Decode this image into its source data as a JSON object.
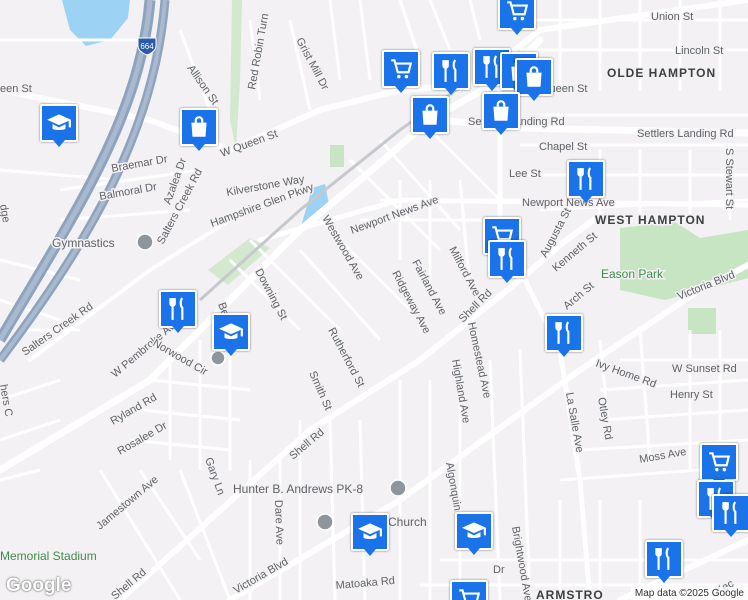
{
  "map": {
    "area_labels": [
      "OLDE HAMPTON",
      "WEST HAMPTON"
    ],
    "park_label": "Eason Park",
    "stadium_label": "Memorial Stadium",
    "poi_labels": {
      "gymnastics": "Gymnastics",
      "school": "Hunter B. Andrews PK-8",
      "church": "Church"
    },
    "streets": {
      "union": "Union St",
      "lincoln": "Lincoln St",
      "queen_e": "Queen St",
      "queen_w": "een St",
      "w_queen": "W Queen St",
      "settlers": "Settlers Landing Rd",
      "settlers2": "Settlers Landing Rd",
      "chapel": "Chapel St",
      "lee": "Lee St",
      "s_stewart": "S Stewart St",
      "newport": "Newport News Ave",
      "newport2": "Newport News Ave",
      "augusta": "Augusta St",
      "kenneth": "Kenneth St",
      "arch": "Arch St",
      "victoria_e": "Victoria Blvd",
      "victoria_w": "Victoria Blvd",
      "w_sunset": "W Sunset Rd",
      "henry": "Henry St",
      "ivy": "Ivy Home Rd",
      "otley": "Otley Rd",
      "moss": "Moss Ave",
      "la_salle": "La Salle Ave",
      "brightwood": "Brightwood Ave",
      "algonquin": "Algonquin Rd",
      "highland": "Highland Ave",
      "homestead": "Homestead Ave",
      "milford": "Milford Ave",
      "fairland": "Fairland Ave",
      "ridgeway": "Ridgeway Ave",
      "shell_e": "Shell Rd",
      "shell_w": "Shell Rd",
      "shell_sw": "Shell Rd",
      "rutherford": "Rutherford St",
      "smith": "Smith St",
      "downing": "Downing St",
      "westwood": "Westwood Ave",
      "hampshire": "Hampshire Glen Pkwy",
      "kilverstone": "Kilverstone Way",
      "salters": "Salters Creek Rd",
      "salters2": "Salters Creek Rd",
      "azalea": "Azalea Dr",
      "balmoral": "Balmoral Dr",
      "braemar": "Braemar Dr",
      "allison": "Allison St",
      "red_robin": "Red Robin Turn",
      "grist_mill": "Grist Mill Dr",
      "w_pembroke": "W Pembroke Ave",
      "norwood": "Norwood Cir",
      "ryland": "Ryland Rd",
      "rosalee": "Rosalee Dr",
      "gary": "Gary Ln",
      "jamestown": "Jamestown Ave",
      "dare": "Dare Ave",
      "matoaka": "Matoaka Rd",
      "kecoughtan": "Kec",
      "armstrong": "ARMSTRO",
      "dr": "Dr",
      "ridge": "dge",
      "chers": "hers C",
      "be": "Be"
    },
    "highway_shield": "664",
    "attribution": "Map data ©2025 Google",
    "logo": "Google"
  },
  "markers": [
    {
      "icon": "shopping-cart-icon"
    },
    {
      "icon": "shopping-cart-icon"
    },
    {
      "icon": "restaurant-icon"
    },
    {
      "icon": "restaurant-icon"
    },
    {
      "icon": "shopping-bag-icon"
    },
    {
      "icon": "shopping-bag-icon"
    },
    {
      "icon": "shopping-bag-icon"
    },
    {
      "icon": "shopping-bag-icon"
    },
    {
      "icon": "school-icon"
    },
    {
      "icon": "restaurant-icon"
    },
    {
      "icon": "shopping-cart-icon"
    },
    {
      "icon": "restaurant-icon"
    },
    {
      "icon": "restaurant-icon"
    },
    {
      "icon": "school-icon"
    },
    {
      "icon": "restaurant-icon"
    },
    {
      "icon": "shopping-cart-icon"
    },
    {
      "icon": "restaurant-icon"
    },
    {
      "icon": "restaurant-icon"
    },
    {
      "icon": "school-icon"
    },
    {
      "icon": "school-icon"
    },
    {
      "icon": "restaurant-icon"
    },
    {
      "icon": "shopping-cart-icon"
    }
  ]
}
